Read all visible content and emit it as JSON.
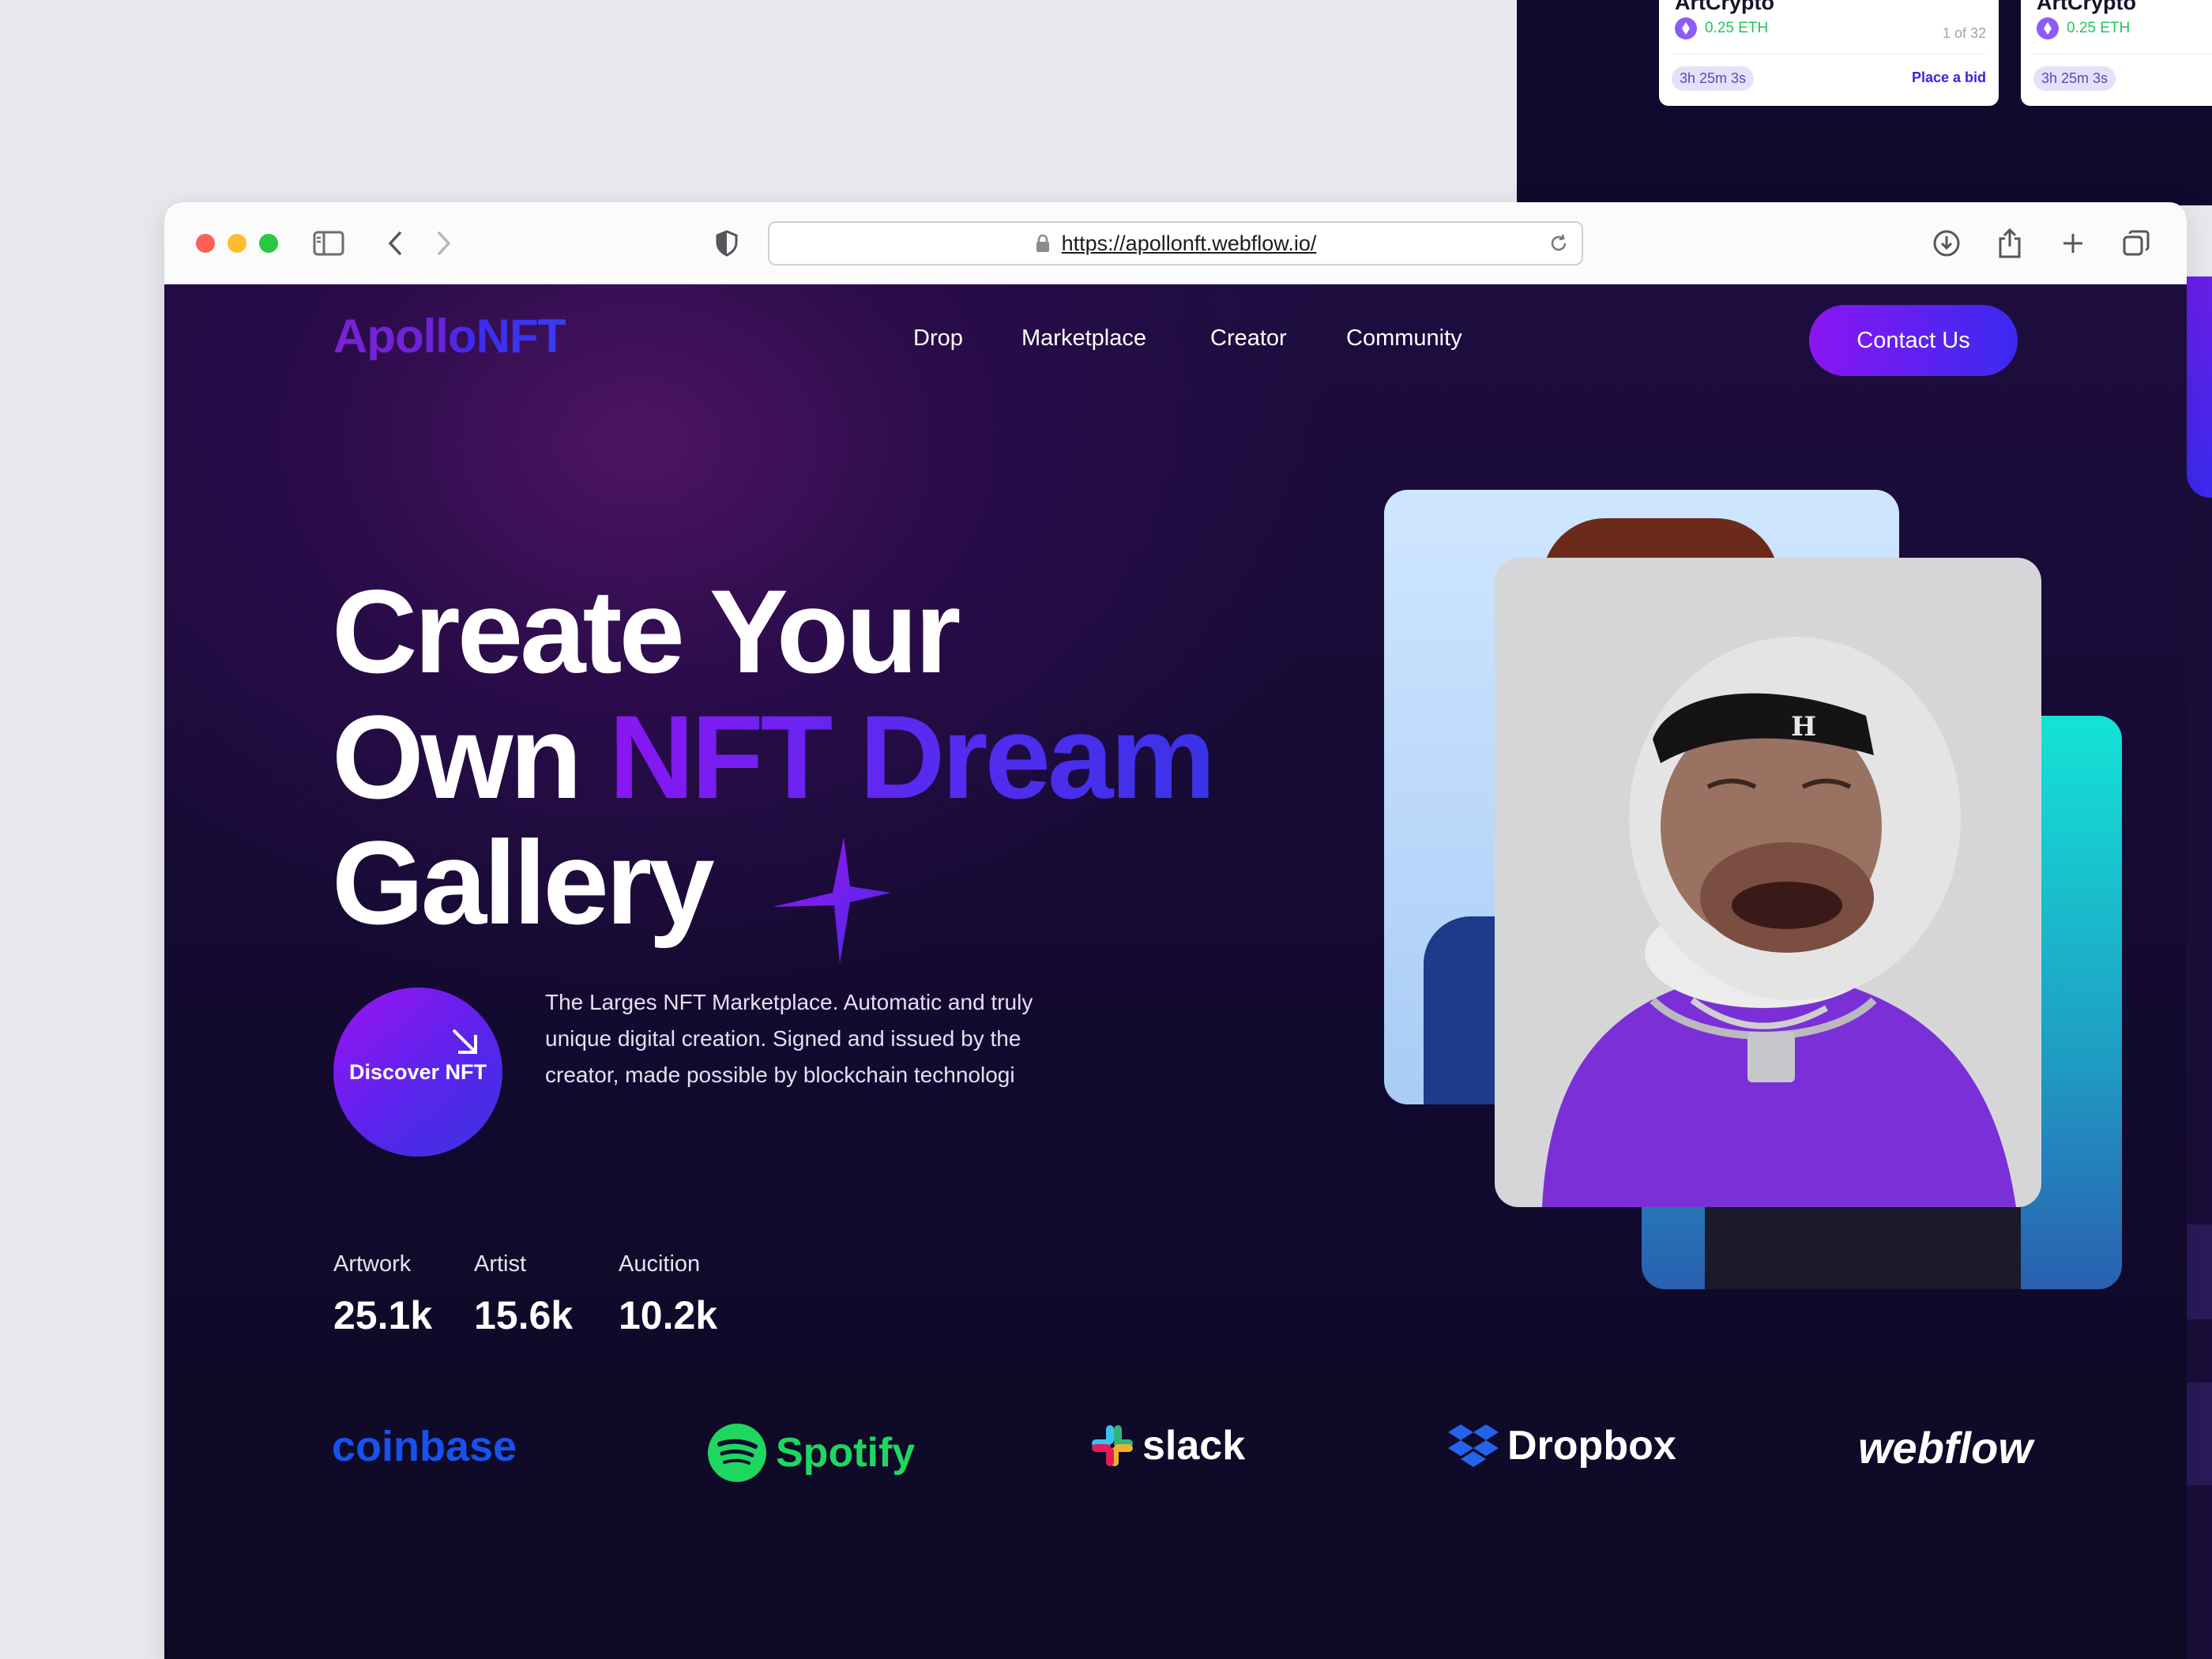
{
  "background_cards": [
    {
      "title": "ArtCrypto",
      "price": "0.25 ETH",
      "edition": "1 of 32",
      "timer": "3h 25m 3s",
      "action": "Place a bid"
    },
    {
      "title": "ArtCrypto",
      "price": "0.25 ETH",
      "timer": "3h 25m 3s"
    }
  ],
  "browser": {
    "url": "https://apollonft.webflow.io/"
  },
  "header": {
    "logo": "ApolloNFT",
    "nav": [
      "Drop",
      "Marketplace",
      "Creator",
      "Community"
    ],
    "cta": "Contact Us"
  },
  "hero": {
    "line1": "Create Your",
    "line2_plain": "Own",
    "line2_accent": "NFT Dream",
    "line3": "Gallery",
    "discover_label": "Discover NFT",
    "description": "The Larges NFT Marketplace. Automatic and truly unique digital creation. Signed and issued by the creator, made possible by blockchain technologi"
  },
  "stats": [
    {
      "label": "Artwork",
      "value": "25.1k"
    },
    {
      "label": "Artist",
      "value": "15.6k"
    },
    {
      "label": "Aucition",
      "value": "10.2k"
    }
  ],
  "partners": [
    "coinbase",
    "Spotify",
    "slack",
    "Dropbox",
    "webflow"
  ],
  "colors": {
    "accent_purple": "#8a16f2",
    "accent_blue": "#3a2af0",
    "page_bg": "#120a2e",
    "coinbase_blue": "#1652f0",
    "spotify_green": "#1ed760"
  },
  "icons": [
    "sidebar-icon",
    "back-chevron-icon",
    "forward-chevron-icon",
    "shield-icon",
    "lock-icon",
    "reload-icon",
    "download-icon",
    "share-icon",
    "plus-icon",
    "tabs-icon",
    "arrow-down-right-icon",
    "sparkle-icon",
    "ethereum-icon"
  ]
}
